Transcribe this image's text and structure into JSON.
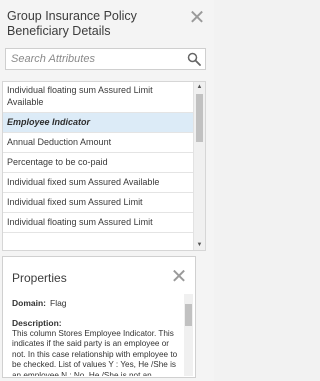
{
  "header": {
    "title": "Group Insurance Policy Beneficiary Details",
    "close_glyph": "✕"
  },
  "search": {
    "placeholder": "Search Attributes",
    "icon": "search-icon"
  },
  "attributes": {
    "items": [
      "Individual floating sum Assured Limit Available",
      "Employee Indicator",
      "Annual Deduction Amount",
      "Percentage to be co-paid",
      "Individual fixed sum Assured Available",
      "Individual fixed sum Assured Limit",
      "Individual floating sum Assured Limit"
    ],
    "selected_index": 1,
    "scroll_up_glyph": "▲",
    "scroll_down_glyph": "▼"
  },
  "properties": {
    "title": "Properties",
    "close_glyph": "✕",
    "domain_label": "Domain:",
    "domain_value": "Flag",
    "description_label": "Description:",
    "description_text": "This column Stores Employee Indicator. This indicates if the said party is an employee or not. In this case relationship with employee to be checked. List of values Y : Yes, He /She is an employee N : No, He /She is not an employee"
  },
  "colors": {
    "selected_row": "#dcebf7",
    "panel_bg": "#f4f4f4"
  }
}
